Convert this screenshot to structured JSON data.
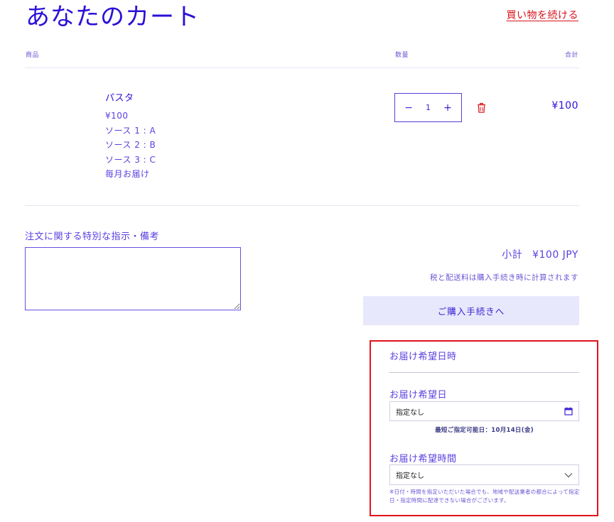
{
  "header": {
    "title": "あなたのカート",
    "continue_shopping": "買い物を続ける"
  },
  "table": {
    "headers": {
      "product": "商品",
      "quantity": "数量",
      "total": "合計"
    }
  },
  "item": {
    "name": "パスタ",
    "price": "¥100",
    "options": [
      "ソース 1 : A",
      "ソース 2 : B",
      "ソース 3 : C",
      "毎月お届け"
    ],
    "quantity": "1",
    "decrease": "−",
    "increase": "+",
    "line_total": "¥100"
  },
  "notes": {
    "label": "注文に関する特別な指示・備考",
    "value": ""
  },
  "summary": {
    "subtotal_label": "小計",
    "subtotal_value": "¥100 JPY",
    "tax_note": "税と配送料は購入手続き時に計算されます",
    "checkout": "ご購入手続きへ"
  },
  "delivery": {
    "title": "お届け希望日時",
    "date_label": "お届け希望日",
    "date_value": "指定なし",
    "earliest": "最短ご指定可能日：10月14日(金)",
    "time_label": "お届け希望時間",
    "time_value": "指定なし",
    "disclaimer": "※日付・時間を指定いただいた場合でも、地域や配送業者の都合によって指定日・指定時間に配達できない場合がございます。"
  },
  "colors": {
    "accent": "#3b1fd1",
    "link_red": "#d7141c",
    "button_bg": "#e8e8fc",
    "highlight_border": "#e0141c"
  },
  "icons": {
    "trash": "trash-icon",
    "calendar": "calendar-icon",
    "chevron": "chevron-down-icon"
  }
}
